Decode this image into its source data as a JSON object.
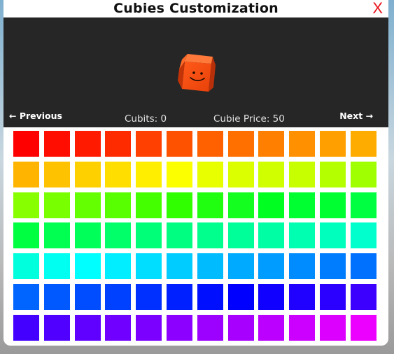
{
  "window": {
    "title": "Cubies Customization",
    "close_label": "X"
  },
  "preview": {
    "cube_color": "#e8410a",
    "prev_label": "← Previous",
    "next_label": "Next →",
    "cubits_text": "Cubits: 0",
    "price_text": "Cubie Price: 50"
  },
  "palette": {
    "columns": 12,
    "rows": 7,
    "colors": [
      "#ff0000",
      "#ff0d00",
      "#ff1a00",
      "#ff2b00",
      "#ff4000",
      "#ff5200",
      "#ff6000",
      "#ff7000",
      "#ff8000",
      "#ff9000",
      "#ffa000",
      "#ffac00",
      "#ffb400",
      "#ffc200",
      "#ffd000",
      "#ffde00",
      "#ffee00",
      "#fbff00",
      "#e8ff00",
      "#dcff00",
      "#d0ff00",
      "#c8ff00",
      "#b4ff00",
      "#a0ff00",
      "#88ff00",
      "#78ff00",
      "#64ff00",
      "#58ff00",
      "#44ff00",
      "#30ff00",
      "#20ff10",
      "#14ff20",
      "#00ff20",
      "#00ff30",
      "#00ff30",
      "#00ff40",
      "#00ff40",
      "#00ff50",
      "#00ff58",
      "#00ff68",
      "#00ff78",
      "#00ff80",
      "#00ff8c",
      "#00ff98",
      "#00ffa4",
      "#00ffb0",
      "#00ffbc",
      "#00ffcc",
      "#00ffdc",
      "#00fff0",
      "#00ffff",
      "#00eeff",
      "#00deff",
      "#00ccff",
      "#00bcff",
      "#00aaff",
      "#009cff",
      "#008cff",
      "#007cff",
      "#0070ff",
      "#0064ff",
      "#0058ff",
      "#004cff",
      "#0040ff",
      "#0030ff",
      "#0020ff",
      "#0010ff",
      "#0000ff",
      "#1000ff",
      "#2000ff",
      "#2c00ff",
      "#3c00ff",
      "#4400ff",
      "#5000ff",
      "#6000ff",
      "#7000ff",
      "#7c00ff",
      "#8c00ff",
      "#9c00ff",
      "#a800ff",
      "#bc00ff",
      "#cc00ff",
      "#dc00ff",
      "#ec00ff"
    ]
  }
}
